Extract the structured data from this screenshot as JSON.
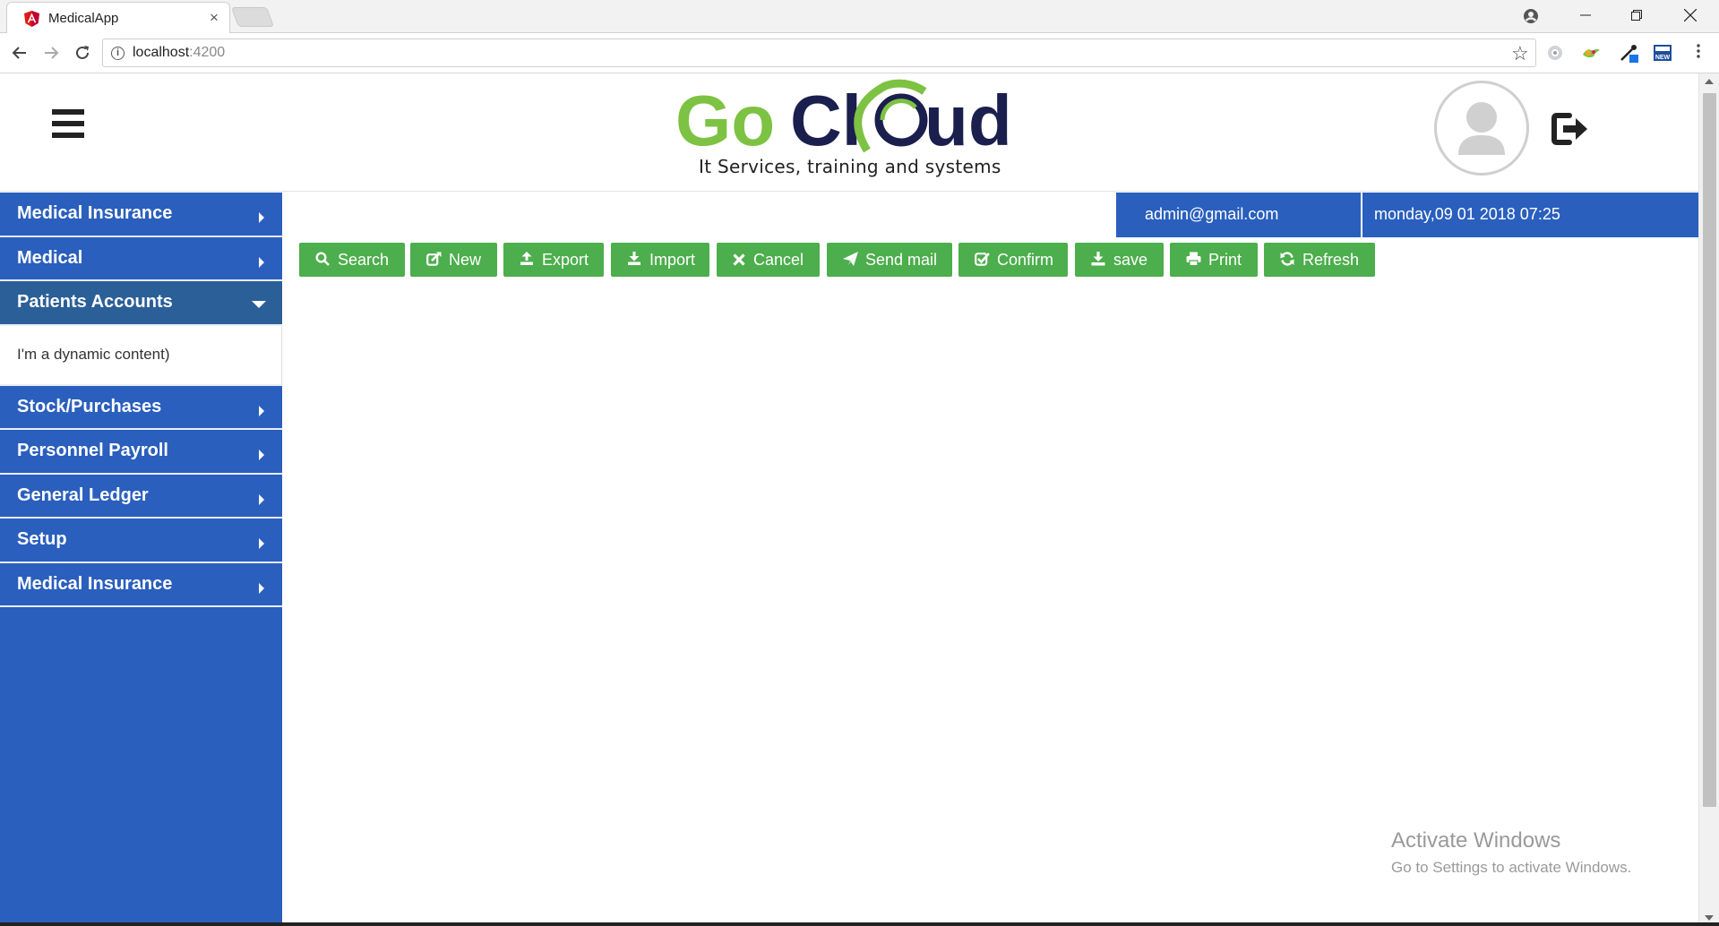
{
  "browser": {
    "tab_title": "MedicalApp",
    "tab_close": "×",
    "url_host": "localhost",
    "url_port": ":4200"
  },
  "header": {
    "logo_text_go": "Go",
    "logo_text_cl": "Cl",
    "logo_text_ud": "ud",
    "tagline": "It Services, training and systems"
  },
  "sidebar": {
    "items": [
      {
        "label": "Medical Insurance"
      },
      {
        "label": "Medical"
      },
      {
        "label": "Patients Accounts"
      },
      {
        "label": "Stock/Purchases"
      },
      {
        "label": "Personnel Payroll"
      },
      {
        "label": "General Ledger"
      },
      {
        "label": "Setup"
      },
      {
        "label": "Medical Insurance"
      }
    ],
    "open_panel_text": "I'm a dynamic content)"
  },
  "userbar": {
    "email": "admin@gmail.com",
    "datetime": "monday,09 01 2018 07:25"
  },
  "actions": {
    "search": "Search",
    "new": "New",
    "export": "Export",
    "import": "Import",
    "cancel": "Cancel",
    "send_mail": "Send mail",
    "confirm": "Confirm",
    "save": "save",
    "print": "Print",
    "refresh": "Refresh"
  },
  "watermark": {
    "title": "Activate Windows",
    "subtitle": "Go to Settings to activate Windows."
  },
  "colors": {
    "primary_blue": "#2a5fbd",
    "active_item": "#2b5f97",
    "button_green": "#4cae4c",
    "logo_green": "#7dc242",
    "logo_navy": "#1b1f4d"
  }
}
